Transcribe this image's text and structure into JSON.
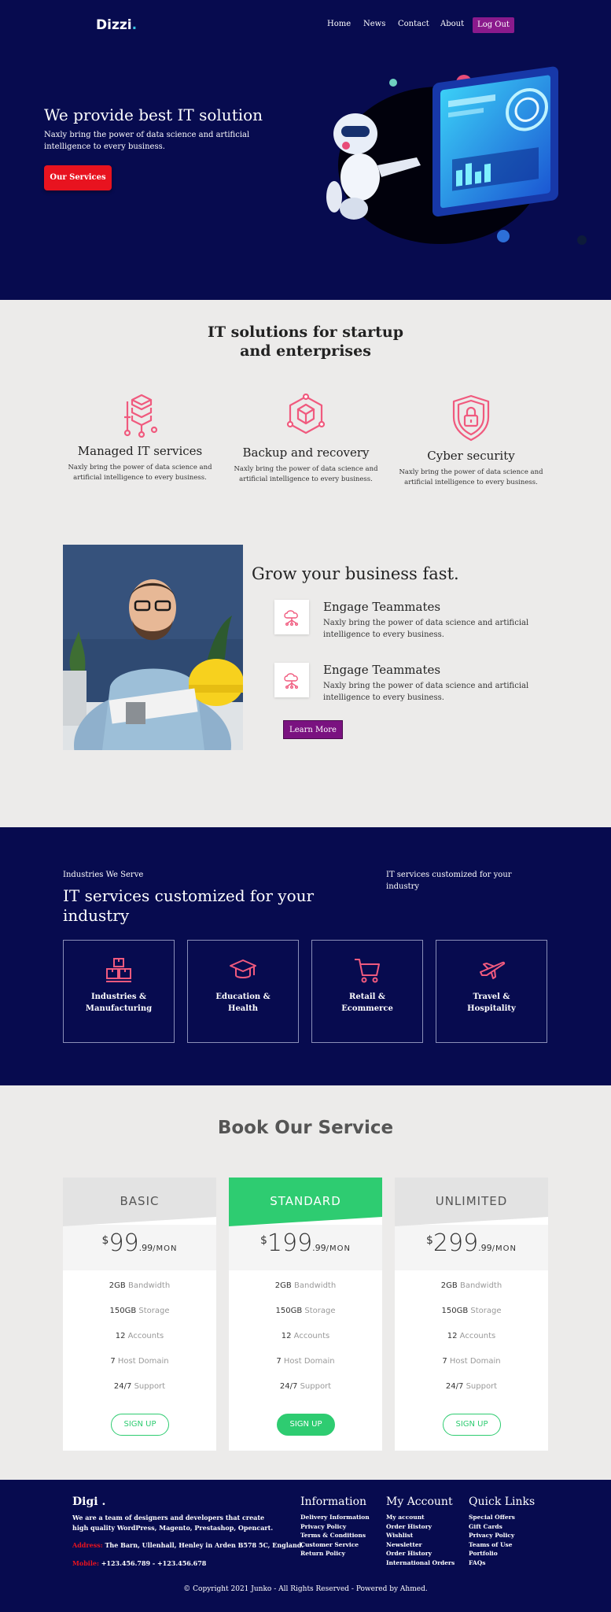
{
  "nav": {
    "logo_text": "Dizzi",
    "logo_dot": ".",
    "links": [
      "Home",
      "News",
      "Contact",
      "About"
    ],
    "logout_label": "Log Out"
  },
  "hero": {
    "title": "We provide best IT solution",
    "subtitle": "Naxly bring the power of data science and artificial intelligence to every business.",
    "button_label": "Our Services"
  },
  "solutions": {
    "title_line1": "IT solutions for startup",
    "title_line2": "and enterprises",
    "cards": [
      {
        "title": "Managed IT services",
        "text": "Naxly bring the power of data science and artificial intelligence to every business.",
        "icon": "server-stack-icon"
      },
      {
        "title": "Backup and recovery",
        "text": "Naxly bring the power of data science and artificial intelligence to every business.",
        "icon": "cube-network-icon"
      },
      {
        "title": "Cyber security",
        "text": "Naxly bring the power of data science and artificial intelligence to every business.",
        "icon": "shield-lock-icon"
      }
    ]
  },
  "grow": {
    "title": "Grow your business fast.",
    "features": [
      {
        "title": "Engage Teammates",
        "text": "Naxly bring the power of data science and artificial intelligence to every business.",
        "icon": "cloud-network-icon"
      },
      {
        "title": "Engage Teammates",
        "text": "Naxly bring the power of data science and artificial intelligence to every business.",
        "icon": "cloud-network-icon"
      }
    ],
    "button_label": "Learn More"
  },
  "industries": {
    "kicker": "Industries We Serve",
    "title": "IT services customized for your industry",
    "side_text": "IT services customized for your industry",
    "cards": [
      {
        "label": "Industries & Manufacturing",
        "icon": "boxes-icon"
      },
      {
        "label": "Education & Health",
        "icon": "graduation-cap-icon"
      },
      {
        "label": "Retail & Ecommerce",
        "icon": "shopping-cart-icon"
      },
      {
        "label": "Travel & Hospitality",
        "icon": "airplane-icon"
      }
    ]
  },
  "pricing": {
    "title": "Book Our Service",
    "currency": "$",
    "per": "/MON",
    "plans": [
      {
        "name": "BASIC",
        "price": "99",
        "cents": ".99",
        "button": "SIGN UP"
      },
      {
        "name": "STANDARD",
        "price": "199",
        "cents": ".99",
        "button": "SIGN UP"
      },
      {
        "name": "UNLIMITED",
        "price": "299",
        "cents": ".99",
        "button": "SIGN UP"
      }
    ],
    "features": [
      {
        "value": "2GB",
        "label": "Bandwidth"
      },
      {
        "value": "150GB",
        "label": "Storage"
      },
      {
        "value": "12",
        "label": "Accounts"
      },
      {
        "value": "7",
        "label": "Host Domain"
      },
      {
        "value": "24/7",
        "label": "Support"
      }
    ]
  },
  "footer": {
    "brand": "Digi .",
    "about": "We are a team of designers and developers that create high quality WordPress, Magento, Prestashop, Opencart.",
    "address_label": "Address:",
    "address": "The Barn, Ullenhall, Henley in Arden B578 5C, England.",
    "mobile_label": "Mobile:",
    "mobile": "+123.456.789 - +123.456.678",
    "columns": [
      {
        "title": "Information",
        "items": [
          "Delivery Information",
          "Privacy Policy",
          "Terms & Conditions",
          "Customer Service",
          "Return Policy"
        ]
      },
      {
        "title": "My Account",
        "items": [
          "My account",
          "Order History",
          "Wishlist",
          "Newsletter",
          "Order History",
          "International Orders"
        ]
      },
      {
        "title": "Quick Links",
        "items": [
          "Special Offers",
          "Gift Cards",
          "Privacy Policy",
          "Teams of Use",
          "Portfolio",
          "FAQs"
        ]
      }
    ],
    "copyright": "© Copyright 2021 Junko - All Rights Reserved - Powered by Ahmed."
  },
  "colors": {
    "navy": "#070b4f",
    "accent_pink": "#f05a7e",
    "red": "#e8131f",
    "purple": "#8a1a8c",
    "green": "#2ecc71"
  }
}
